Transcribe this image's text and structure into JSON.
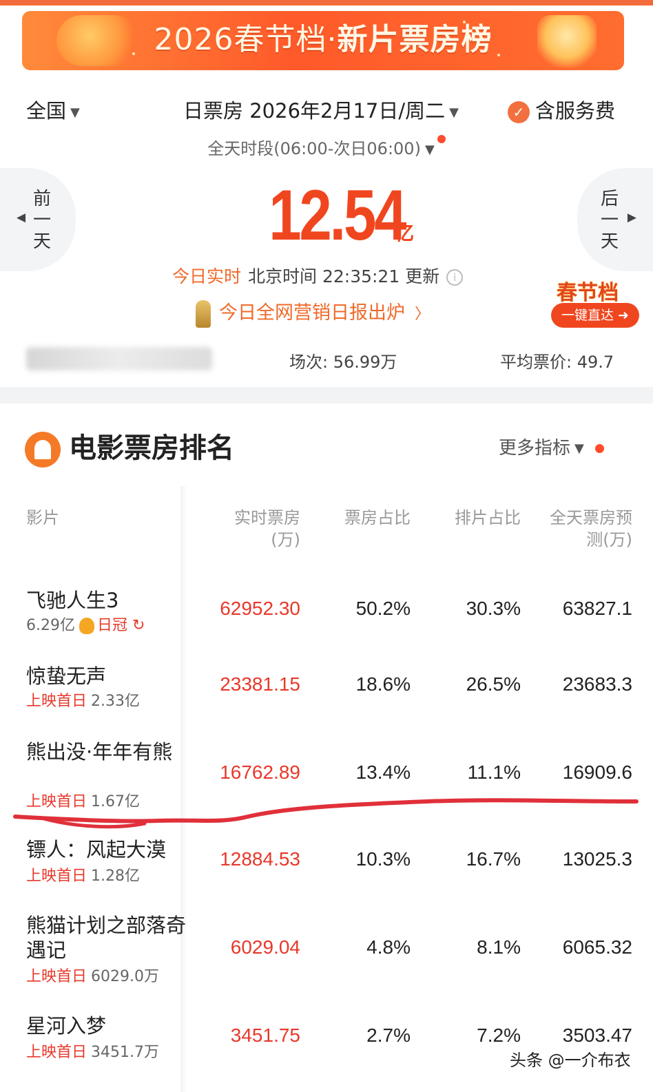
{
  "banner": {
    "year": "2026",
    "title_a": "春节档",
    "title_b": "新片票房榜"
  },
  "filters": {
    "region": "全国",
    "date": "日票房 2026年2月17日/周二",
    "service_fee": "含服务费",
    "period": "全天时段(06:00-次日06:00)"
  },
  "nav": {
    "prev": [
      "前",
      "一",
      "天"
    ],
    "next": [
      "后",
      "一",
      "天"
    ]
  },
  "summary": {
    "total": "12.54",
    "unit": "亿",
    "realtime_tag": "今日实时",
    "update_text": "北京时间 22:35:21 更新",
    "report_text": "今日全网营销日报出炉",
    "festival_badge": "春节档",
    "festival_button": "一键直达",
    "shows": "场次: 56.99万",
    "avg_price": "平均票价: 49.7"
  },
  "ranking": {
    "title": "电影票房排名",
    "more": "更多指标",
    "headers": {
      "film": "影片",
      "box_office": [
        "实时票房",
        "(万)"
      ],
      "box_share": "票房占比",
      "schedule_share": "排片占比",
      "forecast": [
        "全天票房预",
        "测(万)"
      ]
    },
    "rows": [
      {
        "name": "飞驰人生3",
        "sub_label": "",
        "sub_value": "6.29亿",
        "crown": "日冠",
        "box_office": "62952.30",
        "box_share": "50.2%",
        "schedule_share": "30.3%",
        "forecast": "63827.1"
      },
      {
        "name": "惊蛰无声",
        "sub_label": "上映首日",
        "sub_value": "2.33亿",
        "crown": "",
        "box_office": "23381.15",
        "box_share": "18.6%",
        "schedule_share": "26.5%",
        "forecast": "23683.3"
      },
      {
        "name": "熊出没·年年有熊",
        "sub_label": "上映首日",
        "sub_value": "1.67亿",
        "crown": "",
        "box_office": "16762.89",
        "box_share": "13.4%",
        "schedule_share": "11.1%",
        "forecast": "16909.6"
      },
      {
        "name": "镖人：风起大漠",
        "sub_label": "上映首日",
        "sub_value": "1.28亿",
        "crown": "",
        "box_office": "12884.53",
        "box_share": "10.3%",
        "schedule_share": "16.7%",
        "forecast": "13025.3"
      },
      {
        "name": "熊猫计划之部落奇遇记",
        "sub_label": "上映首日",
        "sub_value": "6029.0万",
        "crown": "",
        "box_office": "6029.04",
        "box_share": "4.8%",
        "schedule_share": "8.1%",
        "forecast": "6065.32"
      },
      {
        "name": "星河入梦",
        "sub_label": "上映首日",
        "sub_value": "3451.7万",
        "crown": "",
        "box_office": "3451.75",
        "box_share": "2.7%",
        "schedule_share": "7.2%",
        "forecast": "3503.47"
      }
    ]
  },
  "watermark": "头条 @一介布衣",
  "colors": {
    "accent": "#f0461f",
    "red_value": "#e8382a",
    "orange": "#f06a2a",
    "annotation": "#e0303a"
  }
}
